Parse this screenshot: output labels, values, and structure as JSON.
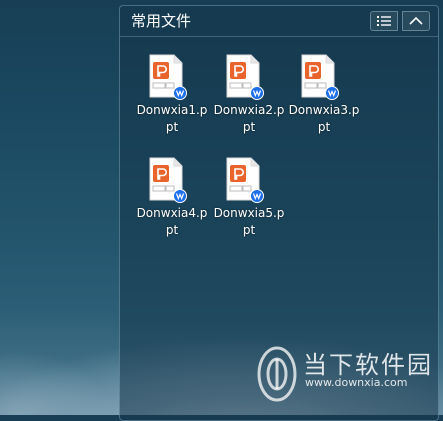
{
  "panel": {
    "title": "常用文件",
    "list_view_icon": "list-icon",
    "collapse_icon": "chevron-up-icon"
  },
  "files": [
    {
      "name": "Donwxia1.ppt",
      "icon": "ppt-file-icon"
    },
    {
      "name": "Donwxia2.ppt",
      "icon": "ppt-file-icon"
    },
    {
      "name": "Donwxia3.ppt",
      "icon": "ppt-file-icon"
    },
    {
      "name": "Donwxia4.ppt",
      "icon": "ppt-file-icon"
    },
    {
      "name": "Donwxia5.ppt",
      "icon": "ppt-file-icon"
    }
  ],
  "watermark": {
    "text": "当下软件园",
    "url": "www.downxia.com"
  },
  "colors": {
    "ppt_accent": "#e8642c",
    "wps_badge": "#1c6fe8"
  }
}
